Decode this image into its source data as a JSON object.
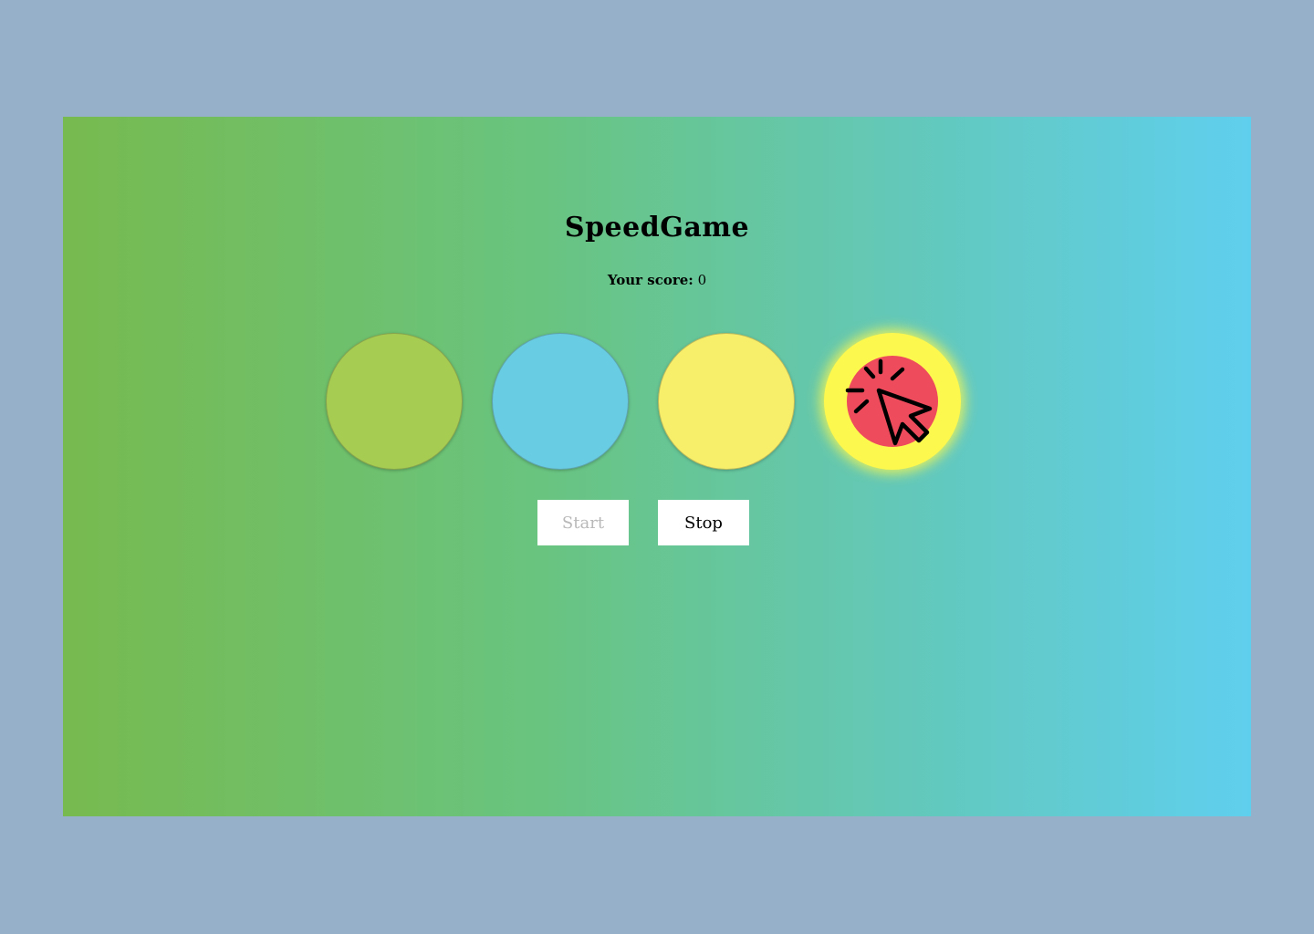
{
  "game": {
    "title": "SpeedGame",
    "score_label": "Your score:",
    "score_value": "0",
    "circles": [
      {
        "color": "#a6cd52"
      },
      {
        "color": "#68cce3"
      },
      {
        "color": "#f7ef6a"
      },
      {
        "color": "#ee4b5c",
        "ring_color": "#fdf84e",
        "active": true,
        "icon": "click-cursor-icon"
      }
    ],
    "buttons": {
      "start_label": "Start",
      "start_disabled": true,
      "stop_label": "Stop"
    }
  }
}
